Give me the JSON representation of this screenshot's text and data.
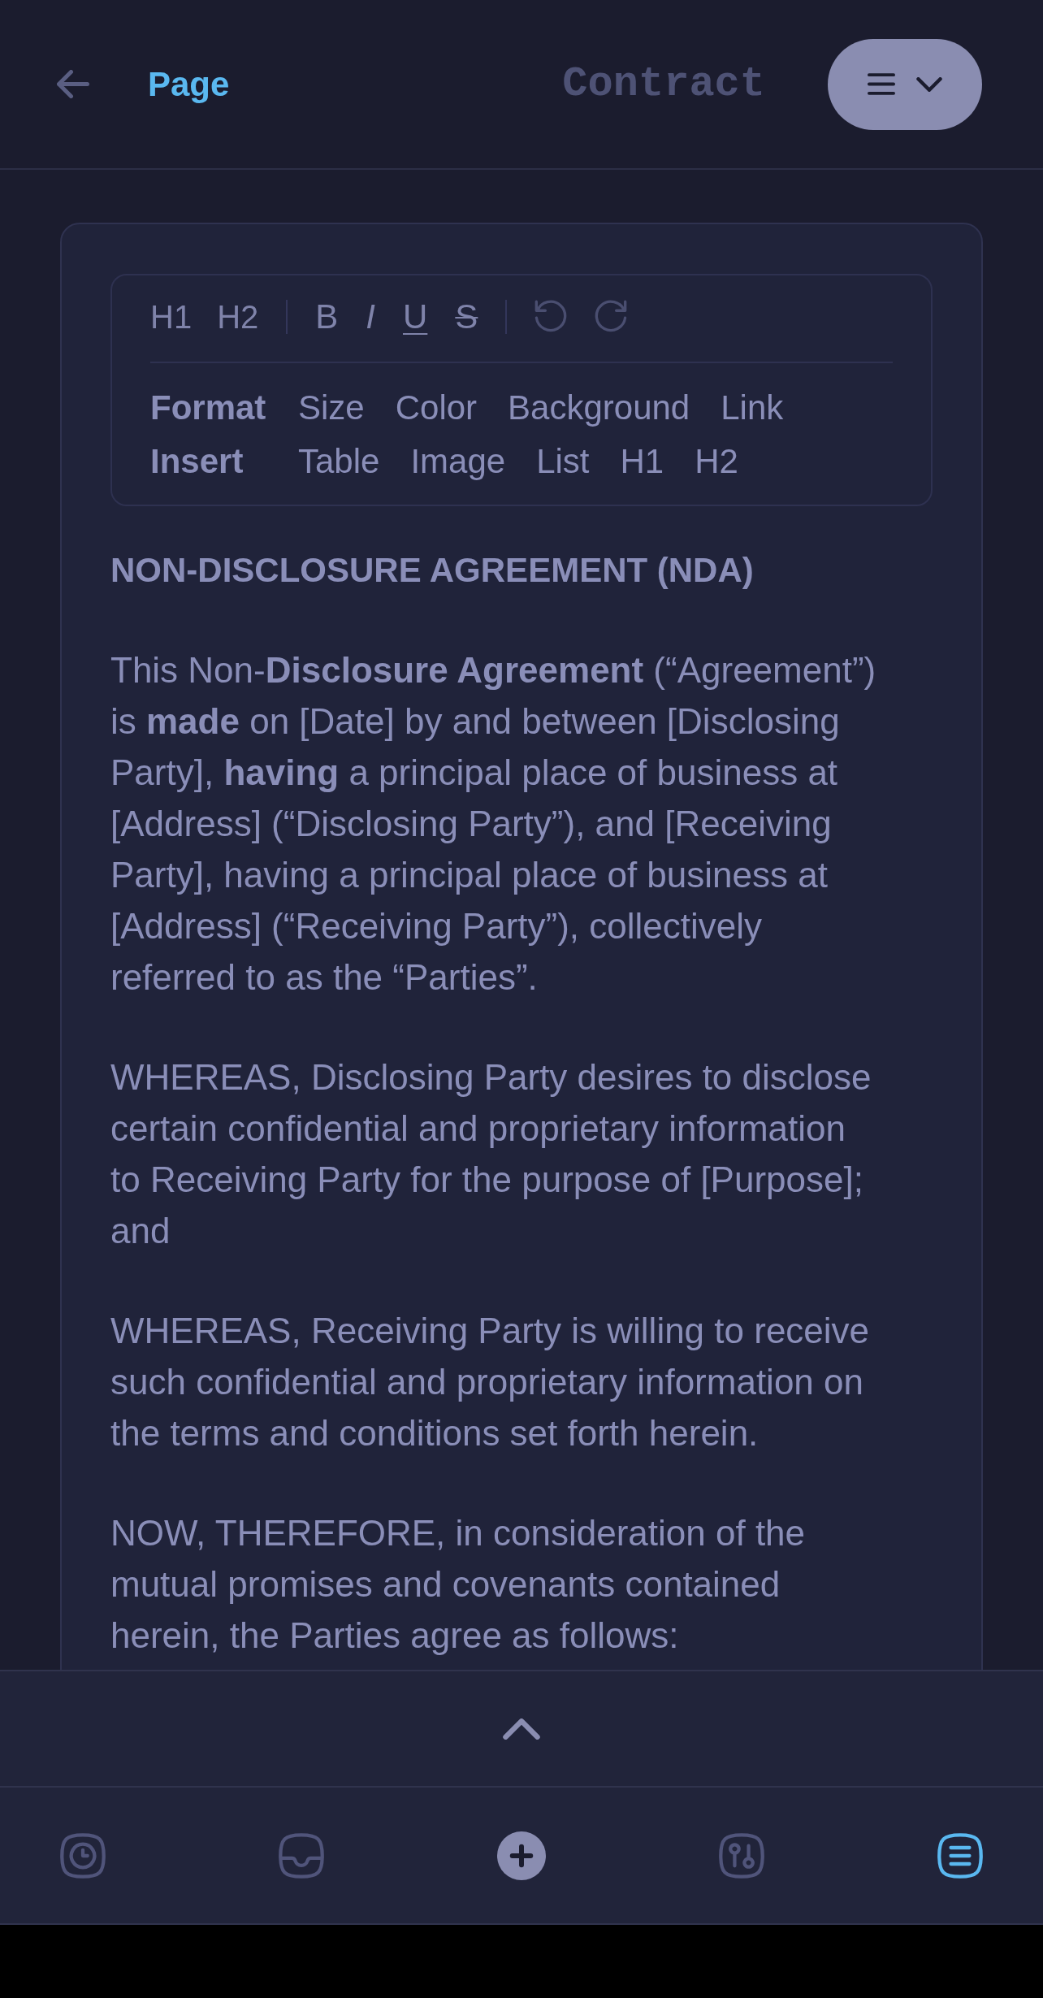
{
  "header": {
    "link": "Page",
    "title": "Contract"
  },
  "toolbar": {
    "heading_buttons": [
      "H1",
      "H2"
    ],
    "style_buttons": [
      {
        "label": "B",
        "kind": "bold"
      },
      {
        "label": "I",
        "kind": "italic"
      },
      {
        "label": "U",
        "kind": "underline"
      },
      {
        "label": "S",
        "kind": "strikethrough"
      }
    ],
    "history_buttons": [
      {
        "kind": "undo",
        "disabled": true
      },
      {
        "kind": "redo",
        "disabled": true
      }
    ],
    "menus": [
      {
        "label": "Format",
        "items": [
          "Size",
          "Color",
          "Background",
          "Link"
        ]
      },
      {
        "label": "Insert",
        "items": [
          "Table",
          "Image",
          "List",
          "H1",
          "H2"
        ]
      }
    ]
  },
  "document": {
    "title": "NON-DISCLOSURE AGREEMENT (NDA)",
    "paragraphs": [
      "This Non-**Disclosure Agreement** (“Agreement”) is **made** on [Date] by and between [Disclosing Party], **having** a principal place of business at [Address] (“Disclosing Party”), and [Receiving Party], having a principal place of business at [Address] (“Receiving Party”), collectively referred to as the “Parties”.",
      "WHEREAS, Disclosing Party desires to disclose certain confidential and proprietary information to Receiving Party for the purpose of [Purpose]; and",
      "WHEREAS, Receiving Party is willing to receive such confidential and proprietary information on the terms and conditions set forth herein.",
      "NOW, THEREFORE, in consideration of the mutual promises and covenants contained herein, the Parties agree as follows:"
    ]
  },
  "bottom_nav": {
    "items": [
      {
        "kind": "recent",
        "selected": false
      },
      {
        "kind": "inbox",
        "selected": false
      },
      {
        "kind": "add",
        "selected": false
      },
      {
        "kind": "adjust",
        "selected": false
      },
      {
        "kind": "notes",
        "selected": true
      }
    ]
  }
}
